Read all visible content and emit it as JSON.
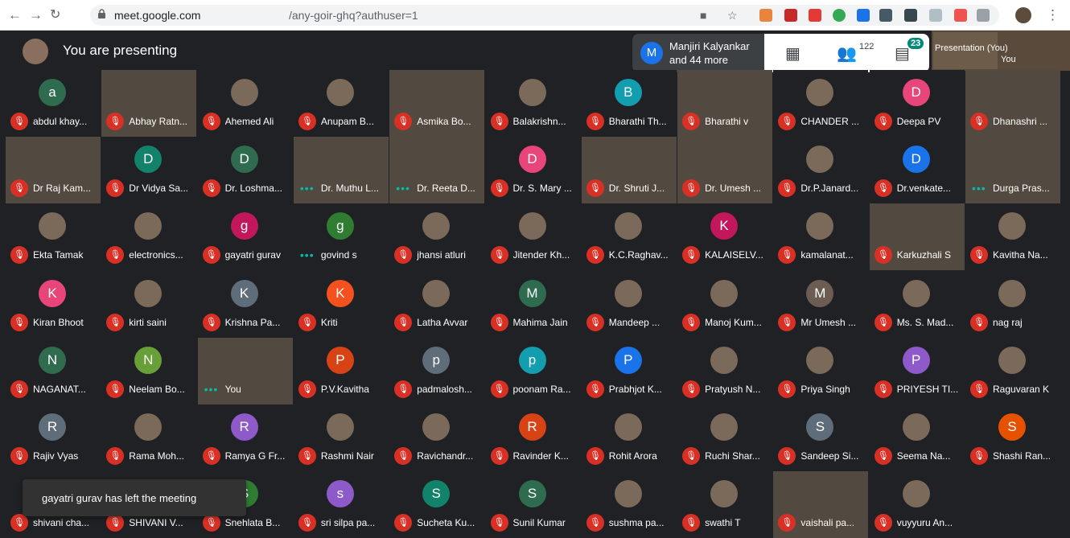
{
  "browser": {
    "url_host": "meet.google.com",
    "url_path": "/any-goir-ghq?authuser=1"
  },
  "meet": {
    "presenting_text": "You are presenting",
    "participant_badge": {
      "avatar_letter": "M",
      "line1": "Manjiri Kalyankar",
      "line2": "and 44 more"
    },
    "people_count": "122",
    "chat_badge": "23",
    "self_presentation_label": "Presentation (You)",
    "self_label": "You",
    "toast": "gayatri gurav has left the meeting"
  },
  "colors": {
    "accent_green": "#00897b",
    "mic_off": "#d93025",
    "meet_bg": "#202124"
  },
  "tiles": [
    {
      "name": "abdul khay...",
      "letter": "a",
      "color": "#2e6b4f",
      "status": "muted"
    },
    {
      "name": "Abhay Ratn...",
      "video": true,
      "status": "muted"
    },
    {
      "name": "Ahemed Ali",
      "photo": true,
      "status": "muted"
    },
    {
      "name": "Anupam B...",
      "photo": true,
      "status": "muted"
    },
    {
      "name": "Asmika Bo...",
      "video": true,
      "status": "muted"
    },
    {
      "name": "Balakrishn...",
      "photo": true,
      "status": "muted"
    },
    {
      "name": "Bharathi Th...",
      "letter": "B",
      "color": "#129eaf",
      "status": "muted"
    },
    {
      "name": "Bharathi v",
      "video": true,
      "status": "muted"
    },
    {
      "name": "CHANDER ...",
      "photo": true,
      "status": "muted"
    },
    {
      "name": "Deepa PV",
      "letter": "D",
      "color": "#e8457a",
      "status": "muted"
    },
    {
      "name": "Dhanashri ...",
      "video": true,
      "status": "muted"
    },
    {
      "name": "Dr Raj Kam...",
      "video": true,
      "status": "muted"
    },
    {
      "name": "Dr Vidya Sa...",
      "letter": "D",
      "color": "#12836a",
      "status": "muted"
    },
    {
      "name": "Dr. Loshma...",
      "letter": "D",
      "color": "#2e6b4f",
      "status": "muted"
    },
    {
      "name": "Dr. Muthu L...",
      "video": true,
      "status": "speaking"
    },
    {
      "name": "Dr. Reeta D...",
      "video": true,
      "status": "speaking"
    },
    {
      "name": "Dr. S. Mary ...",
      "letter": "D",
      "color": "#e8457a",
      "status": "muted"
    },
    {
      "name": "Dr. Shruti J...",
      "video": true,
      "status": "muted"
    },
    {
      "name": "Dr. Umesh ...",
      "video": true,
      "status": "muted"
    },
    {
      "name": "Dr.P.Janard...",
      "photo": true,
      "status": "muted"
    },
    {
      "name": "Dr.venkate...",
      "letter": "D",
      "color": "#1a73e8",
      "status": "muted"
    },
    {
      "name": "Durga Pras...",
      "video": true,
      "status": "speaking"
    },
    {
      "name": "Ekta Tamak",
      "photo": true,
      "status": "muted"
    },
    {
      "name": "electronics...",
      "photo": true,
      "status": "muted"
    },
    {
      "name": "gayatri gurav",
      "letter": "g",
      "color": "#c2185b",
      "status": "muted"
    },
    {
      "name": "govind s",
      "letter": "g",
      "color": "#2e7d32",
      "status": "speaking"
    },
    {
      "name": "jhansi atluri",
      "photo": true,
      "status": "muted"
    },
    {
      "name": "Jitender Kh...",
      "photo": true,
      "status": "muted"
    },
    {
      "name": "K.C.Raghav...",
      "photo": true,
      "status": "muted"
    },
    {
      "name": "KALAISELV...",
      "letter": "K",
      "color": "#c2185b",
      "status": "muted"
    },
    {
      "name": "kamalanat...",
      "photo": true,
      "status": "muted"
    },
    {
      "name": "Karkuzhali S",
      "video": true,
      "status": "muted"
    },
    {
      "name": "Kavitha Na...",
      "photo": true,
      "status": "muted"
    },
    {
      "name": "Kiran Bhoot",
      "letter": "K",
      "color": "#e8457a",
      "status": "muted"
    },
    {
      "name": "kirti saini",
      "photo": true,
      "status": "muted"
    },
    {
      "name": "Krishna Pa...",
      "letter": "K",
      "color": "#5f6d7a",
      "status": "muted"
    },
    {
      "name": "Kriti",
      "letter": "K",
      "color": "#f4511e",
      "status": "muted"
    },
    {
      "name": "Latha Avvar",
      "photo": true,
      "status": "muted"
    },
    {
      "name": "Mahima Jain",
      "letter": "M",
      "color": "#2e6b4f",
      "status": "muted"
    },
    {
      "name": "Mandeep ...",
      "photo": true,
      "status": "muted"
    },
    {
      "name": "Manoj Kum...",
      "photo": true,
      "status": "muted"
    },
    {
      "name": "Mr Umesh ...",
      "letter": "M",
      "color": "#6d5c52",
      "status": "muted"
    },
    {
      "name": "Ms. S. Mad...",
      "photo": true,
      "status": "muted"
    },
    {
      "name": "nag raj",
      "photo": true,
      "status": "muted"
    },
    {
      "name": "NAGANAT...",
      "letter": "N",
      "color": "#2e6b4f",
      "status": "muted"
    },
    {
      "name": "Neelam Bo...",
      "letter": "N",
      "color": "#689f38",
      "status": "muted"
    },
    {
      "name": "You",
      "video": true,
      "status": "speaking"
    },
    {
      "name": "P.V.Kavitha",
      "letter": "P",
      "color": "#d84315",
      "status": "muted"
    },
    {
      "name": "padmalosh...",
      "letter": "p",
      "color": "#5f6d7a",
      "status": "muted"
    },
    {
      "name": "poonam Ra...",
      "letter": "p",
      "color": "#129eaf",
      "status": "muted"
    },
    {
      "name": "Prabhjot K...",
      "letter": "P",
      "color": "#1a73e8",
      "status": "muted"
    },
    {
      "name": "Pratyush N...",
      "photo": true,
      "status": "muted"
    },
    {
      "name": "Priya Singh",
      "photo": true,
      "status": "muted"
    },
    {
      "name": "PRIYESH TI...",
      "letter": "P",
      "color": "#8e59c8",
      "status": "muted"
    },
    {
      "name": "Raguvaran K",
      "photo": true,
      "status": "muted"
    },
    {
      "name": "Rajiv Vyas",
      "letter": "R",
      "color": "#5f6d7a",
      "status": "muted"
    },
    {
      "name": "Rama Moh...",
      "photo": true,
      "status": "muted"
    },
    {
      "name": "Ramya G Fr...",
      "letter": "R",
      "color": "#8e59c8",
      "status": "muted"
    },
    {
      "name": "Rashmi Nair",
      "photo": true,
      "status": "muted"
    },
    {
      "name": "Ravichandr...",
      "photo": true,
      "status": "muted"
    },
    {
      "name": "Ravinder K...",
      "letter": "R",
      "color": "#d84315",
      "status": "muted"
    },
    {
      "name": "Rohit Arora",
      "photo": true,
      "status": "muted"
    },
    {
      "name": "Ruchi Shar...",
      "photo": true,
      "status": "muted"
    },
    {
      "name": "Sandeep Si...",
      "letter": "S",
      "color": "#5f6d7a",
      "status": "muted"
    },
    {
      "name": "Seema Na...",
      "photo": true,
      "status": "muted"
    },
    {
      "name": "Shashi Ran...",
      "letter": "S",
      "color": "#e65100",
      "status": "muted"
    },
    {
      "name": "shivani cha...",
      "letter": "s",
      "color": "#5f6d7a",
      "status": "muted"
    },
    {
      "name": "SHIVANI V...",
      "letter": "S",
      "color": "#d84315",
      "status": "muted"
    },
    {
      "name": "Snehlata B...",
      "letter": "S",
      "color": "#2e7d32",
      "status": "muted"
    },
    {
      "name": "sri silpa pa...",
      "letter": "s",
      "color": "#8e59c8",
      "status": "muted"
    },
    {
      "name": "Sucheta Ku...",
      "letter": "S",
      "color": "#12836a",
      "status": "muted"
    },
    {
      "name": "Sunil Kumar",
      "letter": "S",
      "color": "#2e6b4f",
      "status": "muted"
    },
    {
      "name": "sushma pa...",
      "photo": true,
      "status": "muted"
    },
    {
      "name": "swathi T",
      "photo": true,
      "status": "muted"
    },
    {
      "name": "vaishali pa...",
      "video": true,
      "status": "muted"
    },
    {
      "name": "vuyyuru An...",
      "photo": true,
      "status": "muted"
    }
  ]
}
